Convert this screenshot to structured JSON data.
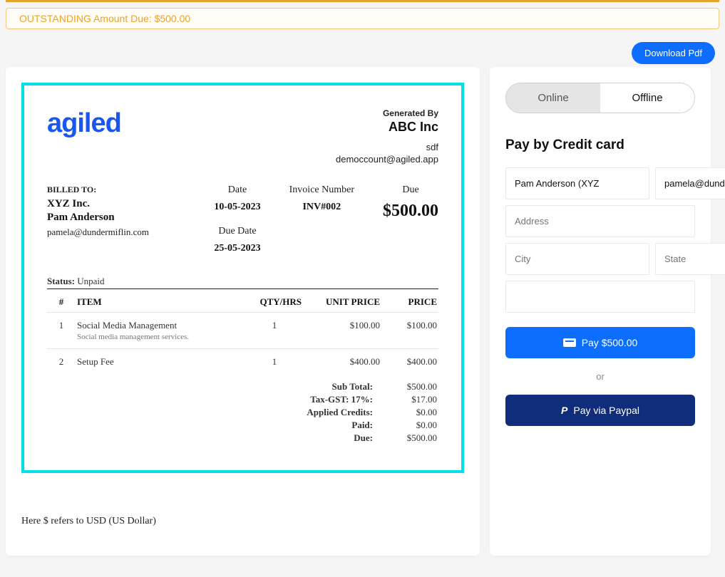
{
  "banner": {
    "text": "OUTSTANDING Amount Due: $500.00"
  },
  "actions": {
    "download": "Download Pdf"
  },
  "invoice": {
    "logo_text": "agiled",
    "generated_by_label": "Generated By",
    "company": "ABC Inc",
    "ref": "sdf",
    "email": "democcount@agiled.app",
    "billed_to": {
      "label": "BILLED TO:",
      "company": "XYZ Inc.",
      "name": "Pam  Anderson",
      "email": "pamela@dundermiflin.com"
    },
    "meta": {
      "date_label": "Date",
      "date": "10-05-2023",
      "due_date_label": "Due Date",
      "due_date": "25-05-2023",
      "inv_num_label": "Invoice Number",
      "inv_num": "INV#002",
      "due_label": "Due",
      "due_amount": "$500.00"
    },
    "status_label": "Status:",
    "status": "Unpaid",
    "columns": {
      "num": "#",
      "item": "ITEM",
      "qty": "QTY/HRS",
      "unit": "UNIT PRICE",
      "price": "PRICE"
    },
    "lines": [
      {
        "n": "1",
        "name": "Social Media Management",
        "desc": "Social media management services.",
        "qty": "1",
        "unit": "$100.00",
        "price": "$100.00"
      },
      {
        "n": "2",
        "name": "Setup Fee",
        "desc": "",
        "qty": "1",
        "unit": "$400.00",
        "price": "$400.00"
      }
    ],
    "totals": {
      "subtotal_label": "Sub Total:",
      "subtotal": "$500.00",
      "tax_label": "Tax-GST: 17%:",
      "tax": "$17.00",
      "credits_label": "Applied Credits:",
      "credits": "$0.00",
      "paid_label": "Paid:",
      "paid": "$0.00",
      "due_label": "Due:",
      "due": "$500.00"
    },
    "note": "Here $ refers to USD (US Dollar)"
  },
  "pay": {
    "tabs": {
      "online": "Online",
      "offline": "Offline"
    },
    "title": "Pay by Credit card",
    "name_value": "Pam Anderson (XYZ",
    "email_value": "pamela@dundermiflin.com",
    "address_ph": "Address",
    "city_ph": "City",
    "state_ph": "State",
    "pay_btn": "Pay $500.00",
    "or": "or",
    "paypal_btn": "Pay via Paypal"
  }
}
